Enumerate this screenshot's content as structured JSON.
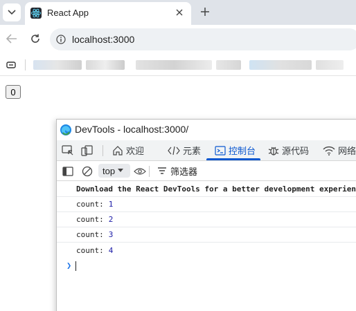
{
  "browser": {
    "tab_title": "React App",
    "url": "localhost:3000"
  },
  "page": {
    "count_button": "0"
  },
  "devtools": {
    "window_title": "DevTools - localhost:3000/",
    "tabs": [
      {
        "label": "欢迎",
        "icon": "home-icon"
      },
      {
        "label": "元素",
        "icon": "code-icon"
      },
      {
        "label": "控制台",
        "icon": "console-icon",
        "active": true
      },
      {
        "label": "源代码",
        "icon": "bug-icon"
      },
      {
        "label": "网络",
        "icon": "wifi-icon"
      }
    ],
    "context": "top",
    "filter_label": "筛选器",
    "console": {
      "lines": [
        {
          "text": "Download the React DevTools for a better development experience"
        },
        {
          "text": "count:",
          "value": "1"
        },
        {
          "text": "count:",
          "value": "2"
        },
        {
          "text": "count:",
          "value": "3"
        },
        {
          "text": "count:",
          "value": "4"
        }
      ]
    }
  },
  "colors": {
    "accent": "#0b57d0",
    "tabstrip": "#dfe3e9",
    "console_number": "#1a1aa6"
  }
}
